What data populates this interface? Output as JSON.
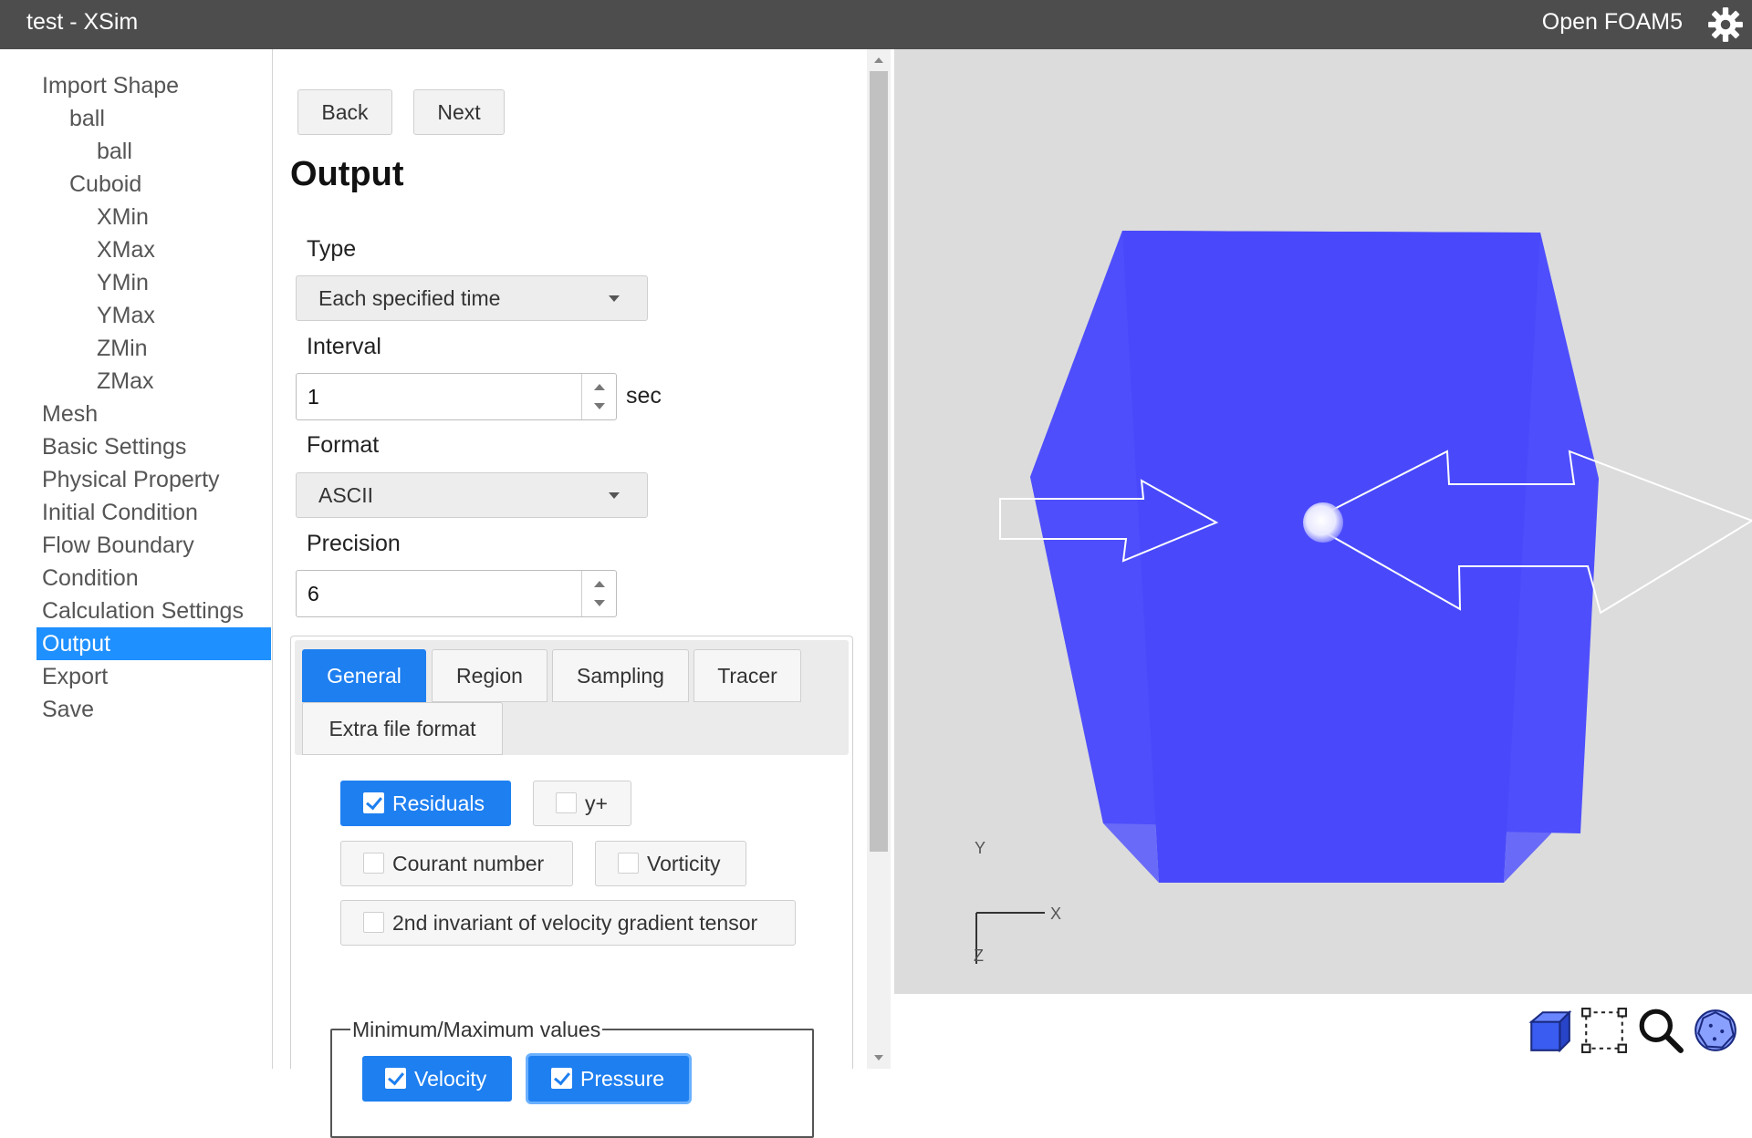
{
  "window": {
    "title": "test - XSim",
    "solver": "Open FOAM5"
  },
  "sidebar": {
    "items": [
      {
        "label": "Import Shape",
        "level": 0
      },
      {
        "label": "ball",
        "level": 1
      },
      {
        "label": "ball",
        "level": 2
      },
      {
        "label": "Cuboid",
        "level": 1
      },
      {
        "label": "XMin",
        "level": 2
      },
      {
        "label": "XMax",
        "level": 2
      },
      {
        "label": "YMin",
        "level": 2
      },
      {
        "label": "YMax",
        "level": 2
      },
      {
        "label": "ZMin",
        "level": 2
      },
      {
        "label": "ZMax",
        "level": 2
      },
      {
        "label": "Mesh",
        "level": 0
      },
      {
        "label": "Basic Settings",
        "level": 0
      },
      {
        "label": "Physical Property",
        "level": 0
      },
      {
        "label": "Initial Condition",
        "level": 0
      },
      {
        "label": "Flow Boundary",
        "level": 0
      },
      {
        "label": "Condition",
        "level": 0
      },
      {
        "label": "Calculation Settings",
        "level": 0
      },
      {
        "label": "Output",
        "level": 0,
        "active": true
      },
      {
        "label": "Export",
        "level": 0
      },
      {
        "label": "Save",
        "level": 0
      }
    ]
  },
  "nav_buttons": {
    "back": "Back",
    "next": "Next"
  },
  "page": {
    "title": "Output"
  },
  "form": {
    "type": {
      "label": "Type",
      "value": "Each specified time"
    },
    "interval": {
      "label": "Interval",
      "value": "1",
      "unit": "sec"
    },
    "format": {
      "label": "Format",
      "value": "ASCII"
    },
    "precision": {
      "label": "Precision",
      "value": "6"
    }
  },
  "tabs": [
    {
      "label": "General",
      "active": true
    },
    {
      "label": "Region"
    },
    {
      "label": "Sampling"
    },
    {
      "label": "Tracer"
    },
    {
      "label": "Extra file format"
    }
  ],
  "general": {
    "residuals": {
      "label": "Residuals",
      "checked": true
    },
    "yplus": {
      "label": "y+",
      "checked": false
    },
    "courant": {
      "label": "Courant number",
      "checked": false
    },
    "vorticity": {
      "label": "Vorticity",
      "checked": false
    },
    "invariant": {
      "label": "2nd invariant of velocity gradient tensor",
      "checked": false
    },
    "minmax": {
      "legend": "Minimum/Maximum values",
      "velocity": {
        "label": "Velocity",
        "checked": true
      },
      "pressure": {
        "label": "Pressure",
        "checked": true
      }
    }
  },
  "viewport": {
    "axes": {
      "y": "Y",
      "x": "X",
      "z": "Z"
    },
    "colors": {
      "domain": "#3c3cff",
      "background": "#dcdcdc",
      "accent": "#1e7ff0"
    }
  },
  "toolbar_icons": [
    "cube-view-icon",
    "box-select-icon",
    "zoom-icon",
    "mesh-sphere-icon"
  ]
}
